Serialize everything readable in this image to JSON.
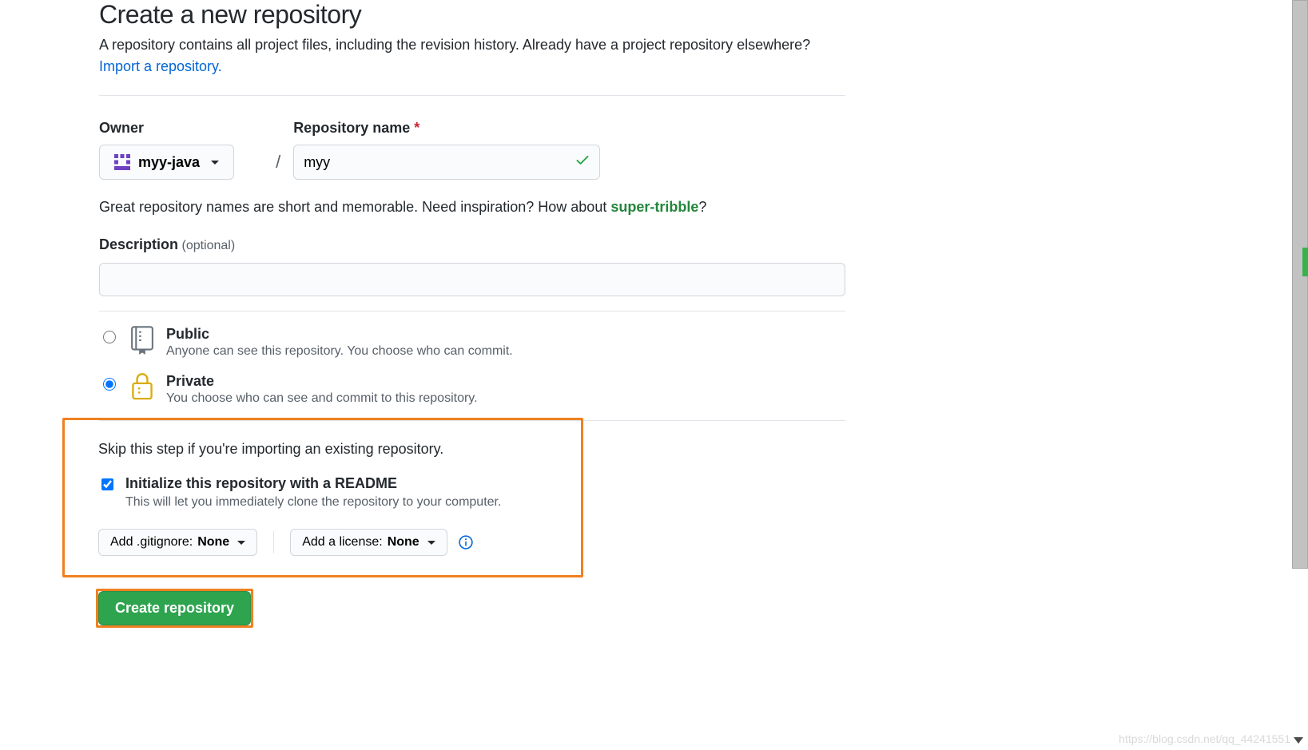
{
  "header": {
    "title": "Create a new repository",
    "subtitle": "A repository contains all project files, including the revision history. Already have a project repository elsewhere?",
    "import_link": "Import a repository."
  },
  "owner": {
    "label": "Owner",
    "value": "myy-java"
  },
  "repo_name": {
    "label": "Repository name",
    "value": "myy",
    "valid": true
  },
  "name_hint": {
    "prefix": "Great repository names are short and memorable. Need inspiration? How about ",
    "suggestion": "super-tribble",
    "suffix": "?"
  },
  "description": {
    "label": "Description",
    "optional": "(optional)",
    "value": ""
  },
  "visibility": {
    "public": {
      "title": "Public",
      "sub": "Anyone can see this repository. You choose who can commit."
    },
    "private": {
      "title": "Private",
      "sub": "You choose who can see and commit to this repository."
    },
    "selected": "private"
  },
  "init": {
    "skip_line": "Skip this step if you're importing an existing repository.",
    "readme_title": "Initialize this repository with a README",
    "readme_sub": "This will let you immediately clone the repository to your computer.",
    "readme_checked": true,
    "gitignore_label": "Add .gitignore:",
    "gitignore_value": "None",
    "license_label": "Add a license:",
    "license_value": "None"
  },
  "submit_label": "Create repository",
  "watermark": "https://blog.csdn.net/qq_44241551"
}
